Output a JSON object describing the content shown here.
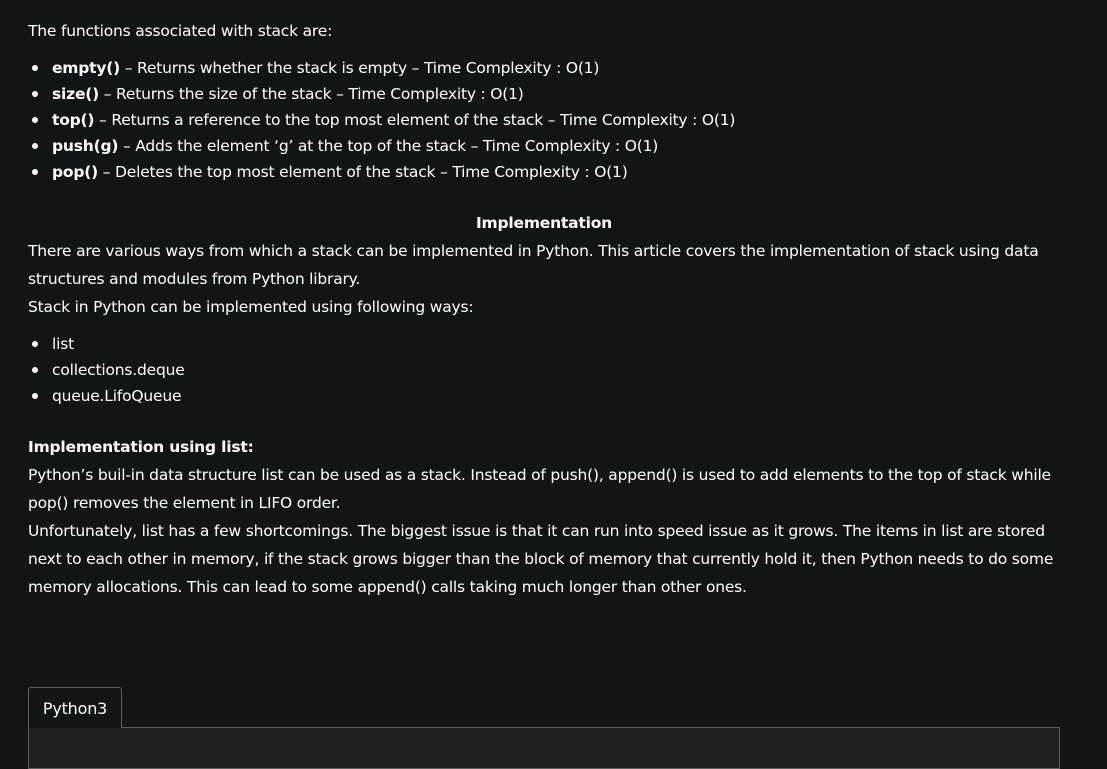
{
  "intro": "The functions associated with stack are:",
  "functions": [
    {
      "name": "empty()",
      "desc": " – Returns whether the stack is empty – Time Complexity : O(1)"
    },
    {
      "name": "size()",
      "desc": " – Returns the size of the stack – Time Complexity : O(1)"
    },
    {
      "name": "top()",
      "desc": " – Returns a reference to the top most element of the stack – Time Complexity : O(1)"
    },
    {
      "name": "push(g)",
      "desc": " – Adds the element ‘g’ at the top of the stack – Time Complexity : O(1)"
    },
    {
      "name": "pop()",
      "desc": " – Deletes the top most element of the stack – Time Complexity : O(1)"
    }
  ],
  "implementation_heading": "Implementation",
  "implementation_para": "There are various ways from which a stack can be implemented in Python. This article covers the implementation of stack using data structures and modules from Python library.",
  "ways_intro": "Stack in Python can be implemented using following ways:",
  "ways": [
    "list",
    "collections.deque",
    "queue.LifoQueue"
  ],
  "list_heading": "Implementation using list:",
  "list_para1": "Python’s buil-in data structure list can be used as a stack. Instead of push(), append() is used to add elements to the top of stack while pop() removes the element in LIFO order.",
  "list_para2": "Unfortunately, list has a few shortcomings. The biggest issue is that it can run into speed issue as it grows. The items in list are stored next to each other in memory, if the stack grows bigger than the block of memory that currently hold it, then Python needs to do some memory allocations. This can lead to some append() calls taking much longer than other ones.",
  "code_tab_label": "Python3"
}
